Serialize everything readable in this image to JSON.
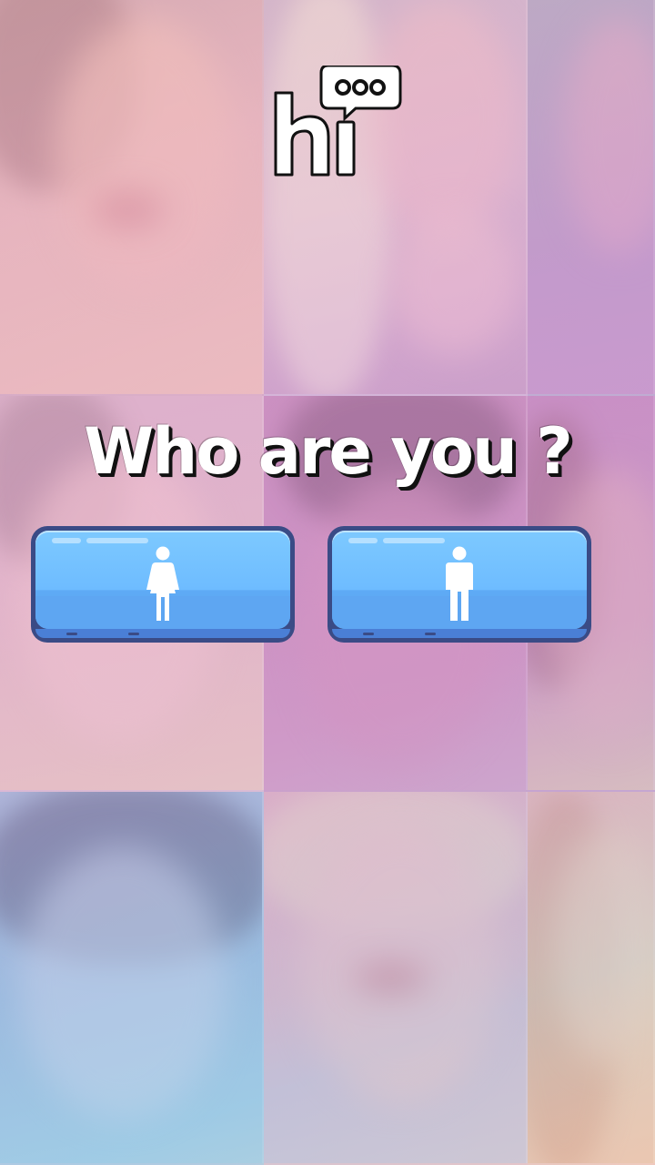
{
  "app": {
    "logo_text": "hi"
  },
  "title": "Who are you ?",
  "buttons": {
    "female": {
      "icon": "female-icon"
    },
    "male": {
      "icon": "male-icon"
    }
  },
  "colors": {
    "button_face": "#6ebcff",
    "button_border": "#3a4b86",
    "title_text": "#ffffff",
    "title_shadow": "#111111"
  }
}
